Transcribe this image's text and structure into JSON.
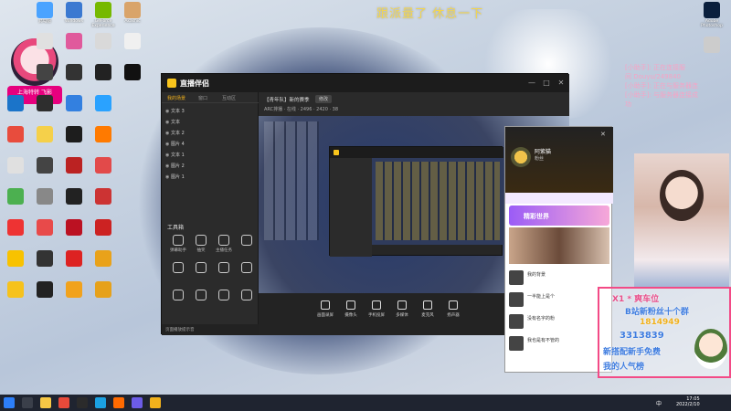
{
  "banner": {
    "text": "跟派量了 休息一下"
  },
  "avatar_widget": {
    "label": "上海特转\n飞影"
  },
  "desktop_icons": [
    {
      "label": "此电脑",
      "color": "#4aa3ff"
    },
    {
      "label": "Windows",
      "color": "#3b79d1"
    },
    {
      "label": "GeForce Experience",
      "color": "#76b900"
    },
    {
      "label": "Akashic",
      "color": "#d9a46a"
    },
    {
      "label": "",
      "color": "#e0e0e0"
    },
    {
      "label": "",
      "color": "#e05a9c"
    },
    {
      "label": "",
      "color": "#d9d9d9"
    },
    {
      "label": "",
      "color": "#f0f0f0"
    },
    {
      "label": "",
      "color": "#444"
    },
    {
      "label": "",
      "color": "#333"
    },
    {
      "label": "",
      "color": "#222"
    },
    {
      "label": "",
      "color": "#111"
    },
    {
      "label": "",
      "color": "#1b74c9"
    },
    {
      "label": "",
      "color": "#2e2e2e"
    },
    {
      "label": "",
      "color": "#3380e0"
    },
    {
      "label": "",
      "color": "#2aa2ff"
    },
    {
      "label": "",
      "color": "#e84c3d"
    },
    {
      "label": "",
      "color": "#f5d04a"
    },
    {
      "label": "",
      "color": "#1d1d1d"
    },
    {
      "label": "",
      "color": "#ff7a00"
    },
    {
      "label": "",
      "color": "#e0e0e0"
    },
    {
      "label": "",
      "color": "#444"
    },
    {
      "label": "",
      "color": "#b22"
    },
    {
      "label": "",
      "color": "#e24a4a"
    },
    {
      "label": "",
      "color": "#4cb050"
    },
    {
      "label": "",
      "color": "#888"
    },
    {
      "label": "",
      "color": "#222"
    },
    {
      "label": "",
      "color": "#c33"
    },
    {
      "label": "",
      "color": "#e33"
    },
    {
      "label": "",
      "color": "#e84a4a"
    },
    {
      "label": "",
      "color": "#b12"
    },
    {
      "label": "",
      "color": "#c22"
    },
    {
      "label": "",
      "color": "#f8c200"
    },
    {
      "label": "",
      "color": "#333"
    },
    {
      "label": "",
      "color": "#d22"
    },
    {
      "label": "",
      "color": "#e9a21a"
    },
    {
      "label": "",
      "color": "#f6c21c"
    },
    {
      "label": "",
      "color": "#222"
    },
    {
      "label": "",
      "color": "#f1a21c"
    },
    {
      "label": "",
      "color": "#e6a11a"
    }
  ],
  "right_icons": [
    {
      "label": "Adobe Photoshop",
      "color": "#0a1f3d"
    },
    {
      "label": "",
      "color": "#ccc"
    }
  ],
  "main_window": {
    "app_title": "直播伴侣",
    "app_chip": "",
    "side_tabs": [
      "我的场景",
      "窗口",
      "互动区"
    ],
    "layers": [
      "文本 3",
      "文本",
      "文本 2",
      "图片 4",
      "文本 1",
      "图片 2",
      "图片 1"
    ],
    "tools_title": "工具箱",
    "tools": [
      "弹幕助手",
      "抽奖",
      "主播任务",
      "",
      "",
      "",
      "",
      "",
      "",
      "",
      "",
      ""
    ],
    "footer_text": "页面播放提示音",
    "room_title": "【青年队】新的赛季",
    "room_edit": "修改",
    "room_stats": "ARC排播 · 在线 · 2496 · 2420 · 38",
    "bottom_tools": [
      "画面录屏",
      "摄像头",
      "手机投屏",
      "多媒体",
      "麦克风",
      "扬声器"
    ],
    "start_button": "",
    "controls": [
      "—",
      "□",
      "✕"
    ]
  },
  "chat_window": {
    "name": "阿紫猫",
    "sub": "粉丝",
    "banner": "精彩世界",
    "items": [
      {
        "text": "我的背景",
        "meta": ""
      },
      {
        "text": "一半能上是个",
        "meta": ""
      },
      {
        "text": "没有名字的粉",
        "meta": ""
      },
      {
        "text": "我也是有不管的",
        "meta": ""
      }
    ]
  },
  "notices": [
    "[小助手]: 正在连接服",
    "间 Douyu/249840",
    "[小助手]: 正在与服务器连",
    "[小助手]: 与服务器连接成",
    "功"
  ],
  "overlay": {
    "line1": "X1 * 爽车位",
    "line2": "B站新粉丝十个群",
    "line3": "1814949",
    "line4": "3313839",
    "line5": "新搭配新手免费",
    "line6": "我的人气榜"
  },
  "taskbar": {
    "lang": "中",
    "time": "17:05",
    "date": "2022/2/10"
  }
}
